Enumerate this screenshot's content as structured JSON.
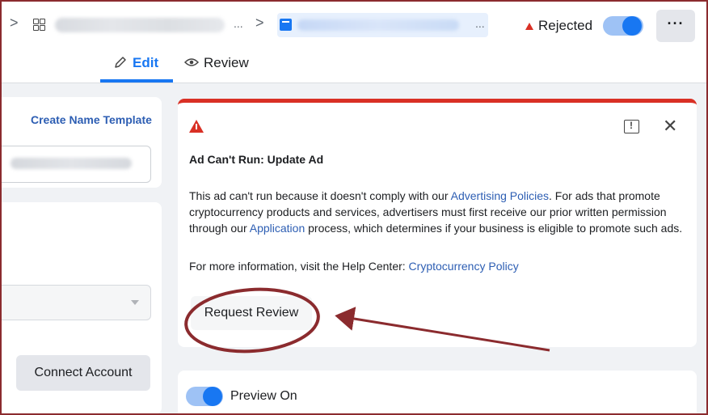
{
  "breadcrumb": {
    "separator": ">",
    "ellipsis": "...",
    "item_icon": "grid-icon",
    "page_icon": "page-icon"
  },
  "status": {
    "label": "Rejected",
    "color": "#d93025",
    "toggle_on": true
  },
  "more_button": {
    "label": "···"
  },
  "tabs": [
    {
      "label": "Edit",
      "icon": "pencil-icon",
      "active": true
    },
    {
      "label": "Review",
      "icon": "eye-icon",
      "active": false
    }
  ],
  "left_panel": {
    "create_name_template": "Create Name Template",
    "connect_account": "Connect Account"
  },
  "alert": {
    "title": "Ad Can't Run: Update Ad",
    "body_1": "This ad can't run because it doesn't comply with our ",
    "link_policies": "Advertising Policies",
    "body_2": ". For ads that promote cryptocurrency products and services, advertisers must first receive our prior written permission through our ",
    "link_application": "Application",
    "body_3": " process, which determines if your business is eligible to promote such ads.",
    "help_prefix": "For more information, visit the Help Center: ",
    "help_link": "Cryptocurrency Policy",
    "request_review": "Request Review"
  },
  "preview": {
    "label": "Preview On",
    "toggle_on": true
  },
  "colors": {
    "accent": "#1877f2",
    "error": "#d93025",
    "annotation": "#8b2b2e"
  }
}
